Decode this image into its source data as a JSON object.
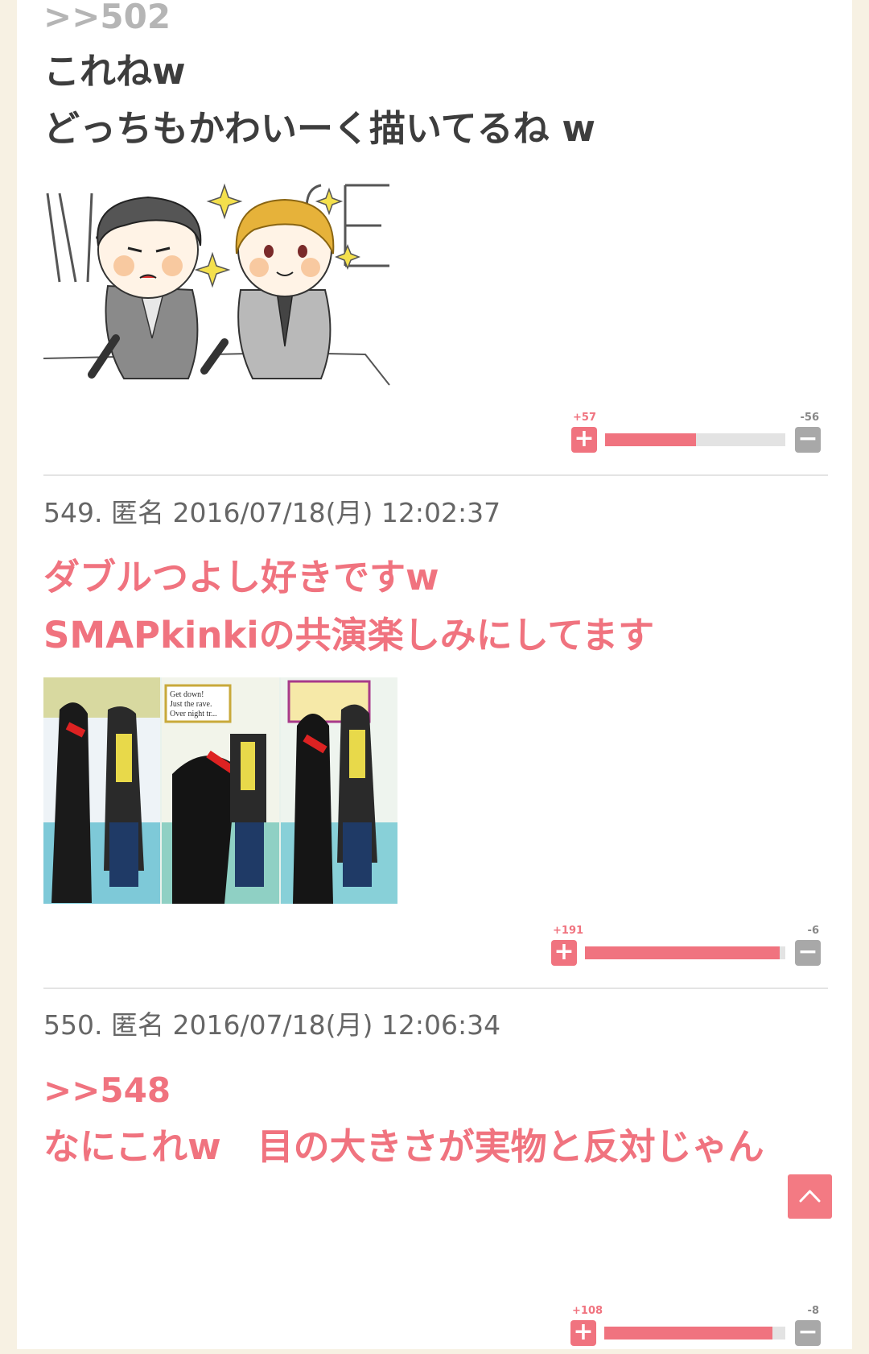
{
  "comments": [
    {
      "reply_ref": ">>502",
      "lines": [
        "これねw",
        "どっちもかわいーく描いてるね w"
      ],
      "votes": {
        "plus": "+57",
        "minus": "-56",
        "ratio": 0.504
      }
    },
    {
      "header": "549. 匿名 2016/07/18(月) 12:02:37",
      "lines": [
        "ダブルつよし好きですw",
        "SMAPkinkiの共演楽しみにしてます"
      ],
      "image_text": {
        "line1": "Get down!",
        "line2": "Just the rave.",
        "line3": "Over night tr..."
      },
      "votes": {
        "plus": "+191",
        "minus": "-6",
        "ratio": 0.97
      }
    },
    {
      "header": "550. 匿名 2016/07/18(月) 12:06:34",
      "reply_ref": ">>548",
      "lines": [
        "なにこれw　目の大きさが実物と反対じゃん"
      ],
      "votes": {
        "plus": "+108",
        "minus": "-8",
        "ratio": 0.93
      }
    }
  ],
  "colors": {
    "accent": "#f0737f",
    "background": "#f7f1e3",
    "vote_minus": "#a8a8a8"
  },
  "icons": {
    "vote_plus": "plus-icon",
    "vote_minus": "minus-icon",
    "scroll_top": "chevron-up-icon"
  }
}
